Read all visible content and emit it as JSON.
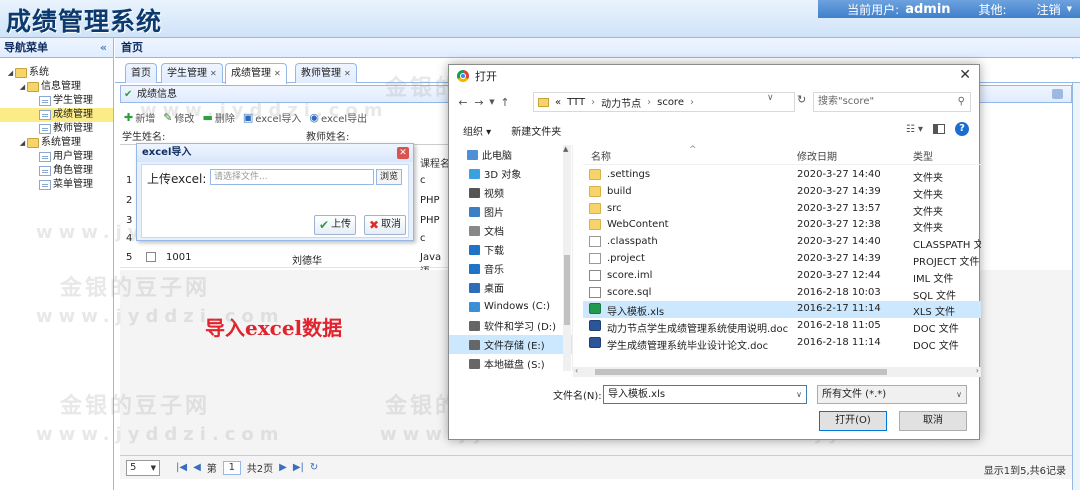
{
  "app": {
    "title": "成绩管理系统",
    "user_label": "当前用户:",
    "user": "admin",
    "other_label": "其他:",
    "logout": "注销"
  },
  "sidebar": {
    "title": "导航菜单",
    "collapse": "«",
    "tree": [
      {
        "label": "系统",
        "type": "folder",
        "level": 0
      },
      {
        "label": "信息管理",
        "type": "folder",
        "level": 1
      },
      {
        "label": "学生管理",
        "type": "file",
        "level": 2
      },
      {
        "label": "成绩管理",
        "type": "file",
        "level": 2,
        "selected": true
      },
      {
        "label": "教师管理",
        "type": "file",
        "level": 2
      },
      {
        "label": "系统管理",
        "type": "folder",
        "level": 1
      },
      {
        "label": "用户管理",
        "type": "file",
        "level": 2
      },
      {
        "label": "角色管理",
        "type": "file",
        "level": 2
      },
      {
        "label": "菜单管理",
        "type": "file",
        "level": 2
      }
    ]
  },
  "main": {
    "home": "首页",
    "tabs": [
      {
        "label": "首页"
      },
      {
        "label": "学生管理"
      },
      {
        "label": "成绩管理",
        "active": true
      },
      {
        "label": "教师管理"
      }
    ],
    "panel_title": "成绩信息",
    "toolbar": {
      "add": "新增",
      "edit": "修改",
      "del": "删除",
      "import": "excel导入",
      "export": "excel导出"
    },
    "search": {
      "student_label": "学生姓名:",
      "teacher_label": "教师姓名:"
    },
    "course_col": "课程名",
    "grid_rows": [
      {
        "no": "1",
        "course": "c"
      },
      {
        "no": "2",
        "course": "PHP"
      },
      {
        "no": "3",
        "course": "PHP"
      },
      {
        "no": "4",
        "course": "c"
      },
      {
        "no": "5",
        "id": "1001",
        "name": "刘德华",
        "course": "Java语"
      }
    ],
    "overlay": "导入excel数据",
    "pager": {
      "size": "5",
      "prefix": "第",
      "page": "1",
      "total": "共2页",
      "info": "显示1到5,共6记录"
    }
  },
  "excel_dialog": {
    "title": "excel导入",
    "label": "上传excel:",
    "placeholder": "请选择文件...",
    "browse": "浏览",
    "upload": "上传",
    "cancel": "取消"
  },
  "file_dialog": {
    "title": "打开",
    "path": [
      "TTT",
      "动力节点",
      "score"
    ],
    "path_prefix": "«",
    "search": "搜索\"score\"",
    "organize": "组织 ▾",
    "new_folder": "新建文件夹",
    "nav": [
      {
        "label": "此电脑",
        "color": "#4f8fd8"
      },
      {
        "label": "3D 对象",
        "color": "#3aa0e0"
      },
      {
        "label": "视频",
        "color": "#555"
      },
      {
        "label": "图片",
        "color": "#3b7fc4"
      },
      {
        "label": "文档",
        "color": "#888"
      },
      {
        "label": "下载",
        "color": "#1c73c7"
      },
      {
        "label": "音乐",
        "color": "#1c73c7"
      },
      {
        "label": "桌面",
        "color": "#2d6cb8"
      },
      {
        "label": "Windows (C:)",
        "color": "#3a8fd6"
      },
      {
        "label": "软件和学习 (D:)",
        "color": "#666"
      },
      {
        "label": "文件存储 (E:)",
        "color": "#666",
        "selected": true
      },
      {
        "label": "本地磁盘 (S:)",
        "color": "#666"
      }
    ],
    "columns": {
      "name": "名称",
      "date": "修改日期",
      "type": "类型"
    },
    "files": [
      {
        "name": ".settings",
        "date": "2020-3-27 14:40",
        "type": "文件夹",
        "icon": "folder"
      },
      {
        "name": "build",
        "date": "2020-3-27 14:39",
        "type": "文件夹",
        "icon": "folder"
      },
      {
        "name": "src",
        "date": "2020-3-27 13:57",
        "type": "文件夹",
        "icon": "folder"
      },
      {
        "name": "WebContent",
        "date": "2020-3-27 12:38",
        "type": "文件夹",
        "icon": "folder"
      },
      {
        "name": ".classpath",
        "date": "2020-3-27 14:40",
        "type": "CLASSPATH 文",
        "icon": "doc"
      },
      {
        "name": ".project",
        "date": "2020-3-27 14:39",
        "type": "PROJECT 文件",
        "icon": "doc"
      },
      {
        "name": "score.iml",
        "date": "2020-3-27 12:44",
        "type": "IML 文件",
        "icon": "pen"
      },
      {
        "name": "score.sql",
        "date": "2016-2-18 10:03",
        "type": "SQL 文件",
        "icon": "pen"
      },
      {
        "name": "导入模板.xls",
        "date": "2016-2-17 11:14",
        "type": "XLS 文件",
        "icon": "xls",
        "selected": true
      },
      {
        "name": "动力节点学生成绩管理系统使用说明.doc",
        "date": "2016-2-18 11:05",
        "type": "DOC 文件",
        "icon": "word"
      },
      {
        "name": "学生成绩管理系统毕业设计论文.doc",
        "date": "2016-2-18 11:14",
        "type": "DOC 文件",
        "icon": "word"
      }
    ],
    "filename_label": "文件名(N):",
    "filename": "导入模板.xls",
    "filetype": "所有文件 (*.*)",
    "open": "打开(O)",
    "cancel": "取消"
  },
  "watermark": {
    "a": "金银的豆子网",
    "b": "www.jyddzi.com"
  }
}
